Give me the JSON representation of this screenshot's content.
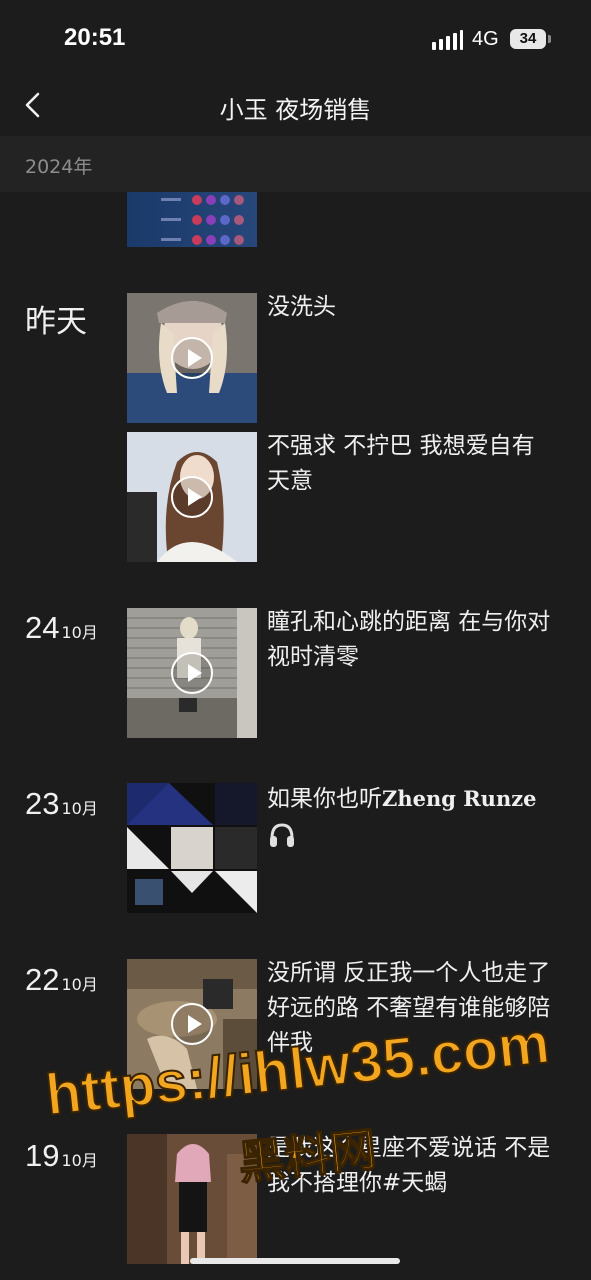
{
  "status": {
    "time": "20:51",
    "network": "4G",
    "battery": "34"
  },
  "nav": {
    "title": "小玉 夜场销售"
  },
  "year_header": "2024年",
  "entries": [
    {
      "day": "",
      "month": "",
      "caption": ""
    },
    {
      "day_label": "昨天",
      "caption": "没洗头",
      "media": "video"
    },
    {
      "caption": "不强求 不拧巴 我想爱自有天意",
      "media": "video"
    },
    {
      "day": "24",
      "month": "10月",
      "caption": "瞳孔和心跳的距离 在与你对视时清零",
      "media": "video"
    },
    {
      "day": "23",
      "month": "10月",
      "caption_prefix": "如果你也听",
      "caption_latin": "Zheng Runze",
      "media": "image-grid"
    },
    {
      "day": "22",
      "month": "10月",
      "caption": "没所谓 反正我一个人也走了好远的路 不奢望有谁能够陪伴我",
      "media": "video"
    },
    {
      "day": "19",
      "month": "10月",
      "caption": "是我这个星座不爱说话 不是我不搭理你#天蝎",
      "media": "image"
    }
  ],
  "icons": {
    "back": "chevron-left-icon",
    "play": "play-icon",
    "headphones": "headphones-icon"
  },
  "watermark": {
    "url": "https://ihlw35.com",
    "label": "黑料网"
  },
  "colors": {
    "background": "#1c1c1c",
    "year_bar": "#232323",
    "watermark": "#f2a51f"
  }
}
